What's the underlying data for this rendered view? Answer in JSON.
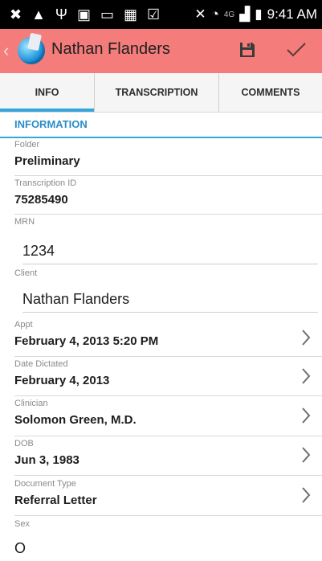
{
  "status_bar": {
    "time": "9:41 AM",
    "network": "4G"
  },
  "header": {
    "title": "Nathan Flanders",
    "bg_color": "#f47c7a"
  },
  "tabs": [
    {
      "label": "INFO",
      "active": true
    },
    {
      "label": "TRANSCRIPTION",
      "active": false
    },
    {
      "label": "COMMENTS",
      "active": false
    }
  ],
  "section": {
    "title": "INFORMATION",
    "accent": "#36a5dc"
  },
  "fields": {
    "folder": {
      "label": "Folder",
      "value": "Preliminary"
    },
    "transcription_id": {
      "label": "Transcription ID",
      "value": "75285490"
    },
    "mrn": {
      "label": "MRN",
      "value": "1234"
    },
    "client": {
      "label": "Client",
      "value": "Nathan Flanders"
    },
    "appt": {
      "label": "Appt",
      "value": "February 4, 2013 5:20 PM"
    },
    "date_dictated": {
      "label": "Date Dictated",
      "value": "February 4, 2013"
    },
    "clinician": {
      "label": "Clinician",
      "value": "Solomon Green, M.D."
    },
    "dob": {
      "label": "DOB",
      "value": "Jun 3, 1983"
    },
    "document_type": {
      "label": "Document Type",
      "value": "Referral Letter"
    },
    "sex": {
      "label": "Sex",
      "value": "O"
    }
  }
}
